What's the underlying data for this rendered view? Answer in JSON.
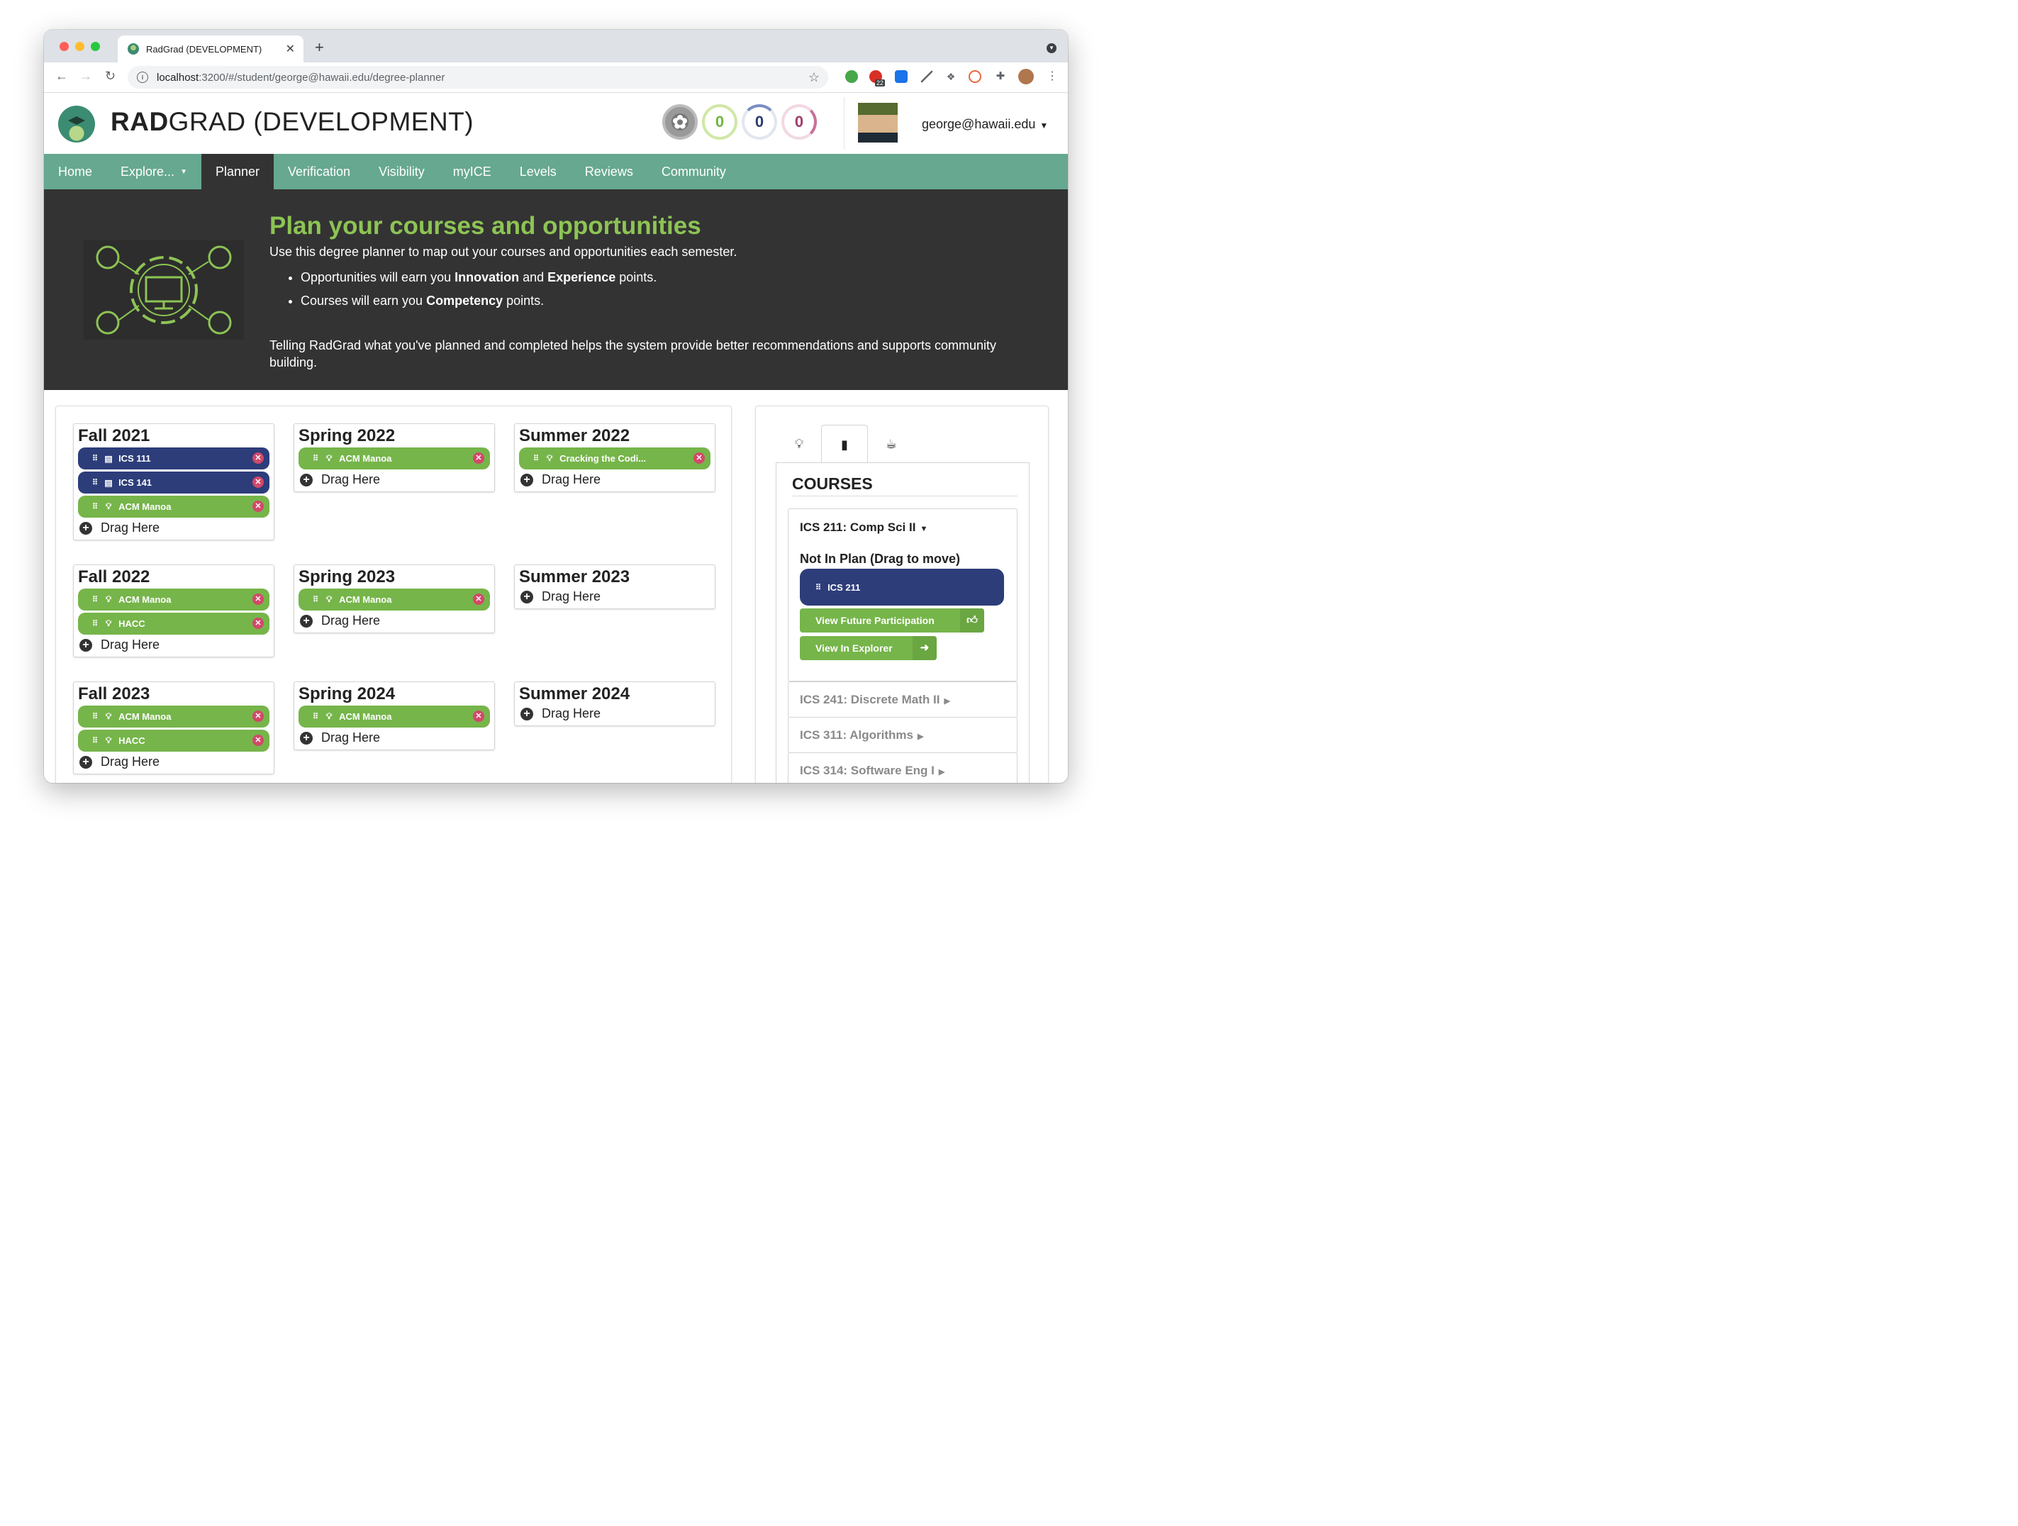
{
  "browser": {
    "tab_title": "RadGrad (DEVELOPMENT)",
    "url_host": "localhost",
    "url_rest": ":3200/#/student/george@hawaii.edu/degree-planner",
    "extension_badge": "22"
  },
  "header": {
    "brand_bold": "RAD",
    "brand_rest": "GRAD (DEVELOPMENT)",
    "ice": {
      "innovation": "0",
      "competency": "0",
      "experience": "0"
    },
    "user_email": "george@hawaii.edu"
  },
  "menu": {
    "items": [
      "Home",
      "Explore...",
      "Planner",
      "Verification",
      "Visibility",
      "myICE",
      "Levels",
      "Reviews",
      "Community"
    ],
    "active": "Planner"
  },
  "hero": {
    "title": "Plan your courses and opportunities",
    "intro": "Use this degree planner to map out your courses and opportunities each semester.",
    "bullet1": {
      "pre": "Opportunities will earn you ",
      "b1": "Innovation",
      "mid": " and ",
      "b2": "Experience",
      "post": " points."
    },
    "bullet2": {
      "pre": "Courses will earn you ",
      "b1": "Competency",
      "post": " points."
    },
    "note": "Telling RadGrad what you've planned and completed helps the system provide better recommendations and supports community building."
  },
  "planner": {
    "drag_label": "Drag Here",
    "semesters": [
      {
        "name": "Fall 2021",
        "items": [
          {
            "label": "ICS 111",
            "kind": "course"
          },
          {
            "label": "ICS 141",
            "kind": "course"
          },
          {
            "label": "ACM Manoa",
            "kind": "opportunity"
          }
        ]
      },
      {
        "name": "Spring 2022",
        "items": [
          {
            "label": "ACM Manoa",
            "kind": "opportunity"
          }
        ]
      },
      {
        "name": "Summer 2022",
        "items": [
          {
            "label": "Cracking the Codi...",
            "kind": "opportunity"
          }
        ]
      },
      {
        "name": "Fall 2022",
        "items": [
          {
            "label": "ACM Manoa",
            "kind": "opportunity"
          },
          {
            "label": "HACC",
            "kind": "opportunity"
          }
        ]
      },
      {
        "name": "Spring 2023",
        "items": [
          {
            "label": "ACM Manoa",
            "kind": "opportunity"
          }
        ]
      },
      {
        "name": "Summer 2023",
        "items": []
      },
      {
        "name": "Fall 2023",
        "items": [
          {
            "label": "ACM Manoa",
            "kind": "opportunity"
          },
          {
            "label": "HACC",
            "kind": "opportunity"
          }
        ]
      },
      {
        "name": "Spring 2024",
        "items": [
          {
            "label": "ACM Manoa",
            "kind": "opportunity"
          }
        ]
      },
      {
        "name": "Summer 2024",
        "items": []
      }
    ]
  },
  "side": {
    "heading": "COURSES",
    "open_course": "ICS 211: Comp Sci II",
    "not_in_plan": "Not In Plan (Drag to move)",
    "plan_pill": "ICS 211",
    "btn_future": "View Future Participation",
    "btn_explorer": "View In Explorer",
    "closed_courses": [
      "ICS 241: Discrete Math II",
      "ICS 311: Algorithms",
      "ICS 314: Software Eng I"
    ]
  }
}
